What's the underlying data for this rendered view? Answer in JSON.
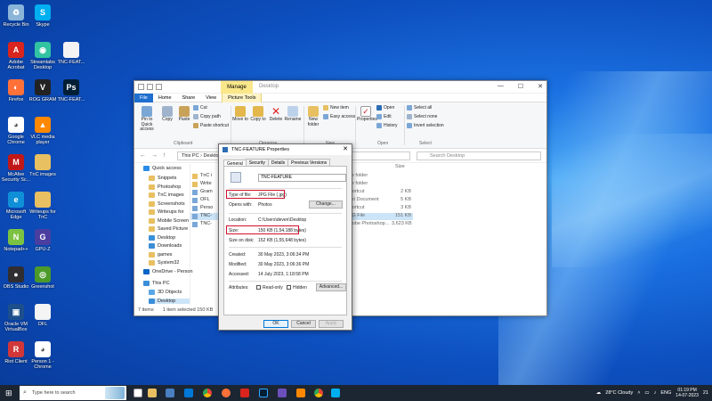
{
  "desktop_icons": [
    {
      "label": "Recycle Bin",
      "icon": "recycle-bin-icon",
      "color": "#8ab4d8",
      "glyph": "♻"
    },
    {
      "label": "Skype",
      "icon": "skype-icon",
      "color": "#00aff0",
      "glyph": "S"
    },
    {
      "label": "Adobe Acrobat",
      "icon": "acrobat-icon",
      "color": "#d9251d",
      "glyph": "A"
    },
    {
      "label": "Streamlabs Desktop",
      "icon": "streamlabs-icon",
      "color": "#31c3a2",
      "glyph": "◉"
    },
    {
      "label": "TNC-FEAT...",
      "icon": "image-file-icon",
      "color": "#f4f4f4",
      "glyph": ""
    },
    {
      "label": "Firefox",
      "icon": "firefox-icon",
      "color": "#ff7139",
      "glyph": "◐"
    },
    {
      "label": "ROG GRAM",
      "icon": "rog-icon",
      "color": "#222222",
      "glyph": "V"
    },
    {
      "label": "TNC-FEAT...",
      "icon": "photoshop-file-icon",
      "color": "#001e36",
      "glyph": "Ps"
    },
    {
      "label": "Google Chrome",
      "icon": "chrome-icon",
      "color": "#ffffff",
      "glyph": "◕"
    },
    {
      "label": "VLC media player",
      "icon": "vlc-icon",
      "color": "#ff8800",
      "glyph": "▲"
    },
    {
      "label": "McAfee Security Sc...",
      "icon": "mcafee-icon",
      "color": "#c01818",
      "glyph": "M"
    },
    {
      "label": "TnC images",
      "icon": "folder-icon",
      "color": "#e8c062",
      "glyph": ""
    },
    {
      "label": "Microsoft Edge",
      "icon": "edge-icon",
      "color": "#0f8fd8",
      "glyph": "e"
    },
    {
      "label": "Writeups for TnC",
      "icon": "folder-icon",
      "color": "#e8c062",
      "glyph": ""
    },
    {
      "label": "Notepad++",
      "icon": "notepadpp-icon",
      "color": "#7cc242",
      "glyph": "N"
    },
    {
      "label": "GPU-Z",
      "icon": "gpuz-icon",
      "color": "#4a3fa0",
      "glyph": "G"
    },
    {
      "label": "OBS Studio",
      "icon": "obs-icon",
      "color": "#302e31",
      "glyph": "●"
    },
    {
      "label": "Greenshot",
      "icon": "greenshot-icon",
      "color": "#4c9a2a",
      "glyph": "◎"
    },
    {
      "label": "Oracle VM VirtualBox",
      "icon": "virtualbox-icon",
      "color": "#1c4f8c",
      "glyph": "▣"
    },
    {
      "label": "OFL",
      "icon": "text-file-icon",
      "color": "#f4f4f4",
      "glyph": ""
    },
    {
      "label": "Riot Client",
      "icon": "riot-icon",
      "color": "#d13639",
      "glyph": "R"
    },
    {
      "label": "Person 1 - Chrome",
      "icon": "chrome-icon",
      "color": "#ffffff",
      "glyph": "◕"
    }
  ],
  "explorer": {
    "manage_tab": "Manage",
    "title": "Desktop",
    "tabs": {
      "file": "File",
      "home": "Home",
      "share": "Share",
      "view": "View",
      "picture_tools": "Picture Tools"
    },
    "ribbon": {
      "pin": "Pin to Quick access",
      "copy": "Copy",
      "paste": "Paste",
      "cut": "Cut",
      "copy_path": "Copy path",
      "paste_shortcut": "Paste shortcut",
      "clipboard": "Clipboard",
      "move_to": "Move to",
      "copy_to": "Copy to",
      "delete": "Delete",
      "rename": "Rename",
      "organize": "Organize",
      "new_folder": "New folder",
      "new_item": "New item",
      "easy_access": "Easy access",
      "new_group": "New",
      "properties": "Properties",
      "open": "Open",
      "edit": "Edit",
      "history": "History",
      "open_group": "Open",
      "select_all": "Select all",
      "select_none": "Select none",
      "invert_selection": "Invert selection",
      "select_group": "Select"
    },
    "address": {
      "path": "This PC  ›  Desktop",
      "search_placeholder": "Search Desktop"
    },
    "nav": {
      "quick_access": "Quick access",
      "items": [
        "Snippets",
        "Photoshop",
        "TnC images",
        "Screenshots",
        "Writeups for",
        "Mobile Screen",
        "Saved Picture",
        "Desktop",
        "Downloads",
        "games",
        "System32"
      ],
      "onedrive": "OneDrive - Person",
      "this_pc": "This PC",
      "objects_3d": "3D Objects",
      "desktop": "Desktop"
    },
    "files": {
      "size_header": "Size",
      "names": [
        "TnC i",
        "Write",
        "Gram",
        "OFL",
        "Perso",
        "TNC-",
        "TNC-"
      ],
      "types": [
        "File folder",
        "File folder",
        "Shortcut",
        "Text Document",
        "Shortcut",
        "JPG File",
        "Adobe Photoshop..."
      ],
      "sizes": [
        "",
        "",
        "2 KB",
        "5 KB",
        "3 KB",
        "151 KB",
        "3,623 KB"
      ]
    },
    "status": {
      "items": "7 items",
      "selected": "1 item selected  150 KB"
    }
  },
  "properties": {
    "title": "TNC-FEATURE Properties",
    "close": "✕",
    "tabs": [
      "General",
      "Security",
      "Details",
      "Previous Versions"
    ],
    "filename": "TNC-FEATURE",
    "type_label": "Type of file:",
    "type_value": "JPG File (.jpg)",
    "opens_label": "Opens with:",
    "opens_value": "Photos",
    "change_button": "Change...",
    "location_label": "Location:",
    "location_value": "C:\\Users\\deven\\Desktop",
    "size_label": "Size:",
    "size_value": "150 KB (1,54,188 bytes)",
    "size_disk_label": "Size on disk:",
    "size_disk_value": "152 KB (1,55,648 bytes)",
    "created_label": "Created:",
    "created_value": "30 May 2023, 3:06:34 PM",
    "modified_label": "Modified:",
    "modified_value": "30 May 2023, 3:06:36 PM",
    "accessed_label": "Accessed:",
    "accessed_value": "14 July 2023, 1:18:58 PM",
    "attributes_label": "Attributes:",
    "readonly_label": "Read-only",
    "hidden_label": "Hidden",
    "advanced_button": "Advanced...",
    "ok_button": "OK",
    "cancel_button": "Cancel",
    "apply_button": "Apply",
    "highlight_color": "#d0102a"
  },
  "taskbar": {
    "search_placeholder": "Type here to search",
    "weather": "28°C  Cloudy",
    "lang": "ENG",
    "time": "01:19 PM",
    "date": "14-07-2023",
    "notif": "21"
  }
}
